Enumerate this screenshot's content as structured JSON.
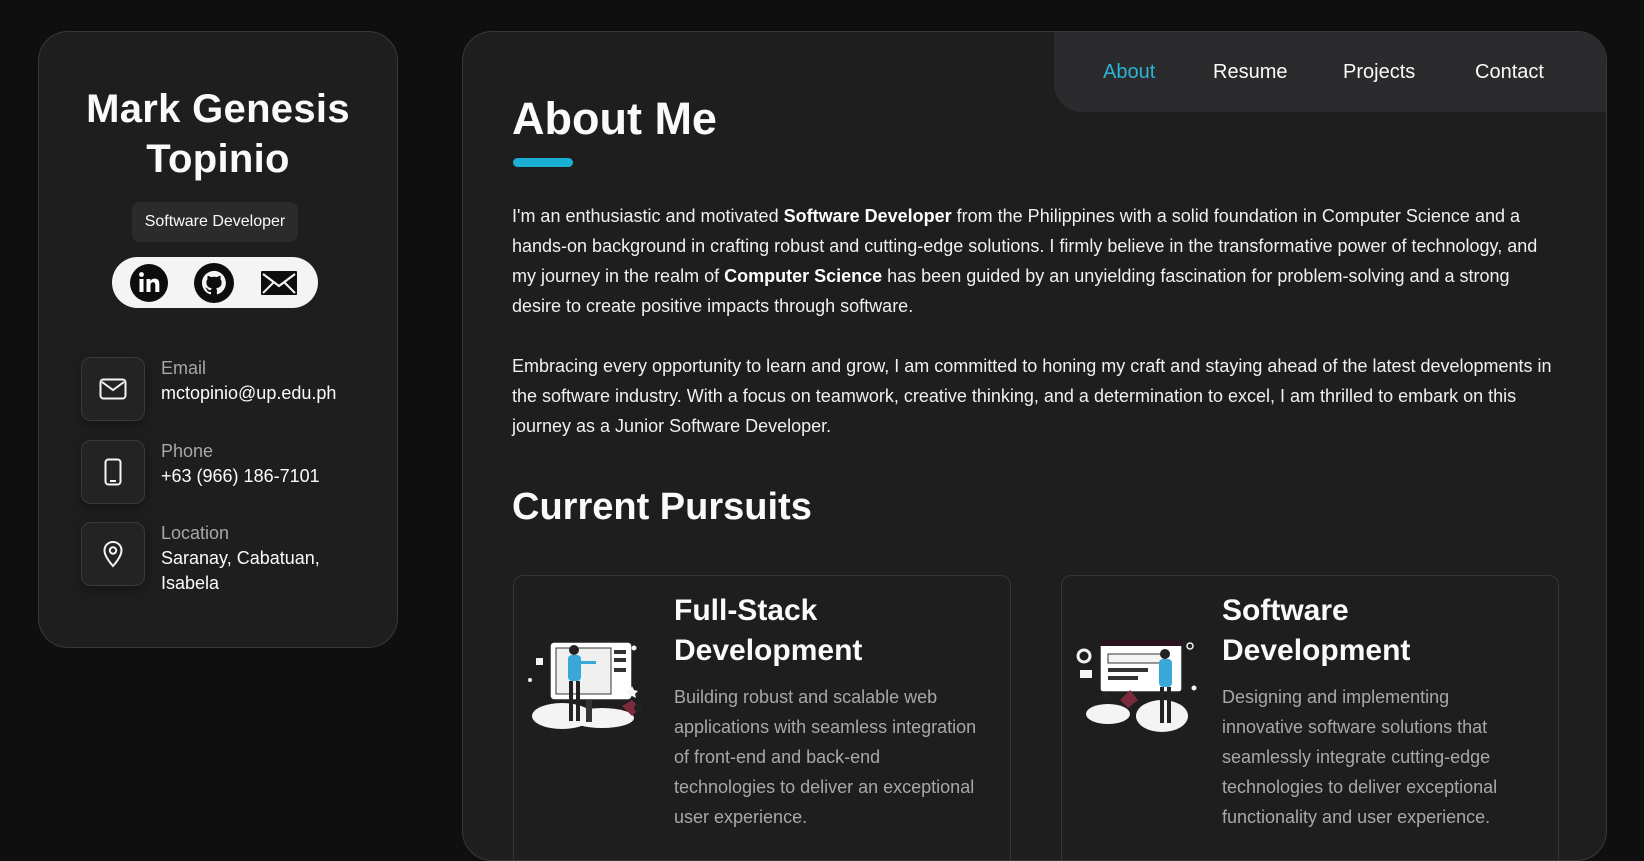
{
  "profile": {
    "name": "Mark Genesis Topinio",
    "role": "Software Developer"
  },
  "social": [
    {
      "icon": "linkedin-icon"
    },
    {
      "icon": "github-icon"
    },
    {
      "icon": "mail-icon"
    }
  ],
  "contacts": [
    {
      "label": "Email",
      "value": "mctopinio@up.edu.ph",
      "icon": "envelope-icon"
    },
    {
      "label": "Phone",
      "value": "+63 (966) 186-7101",
      "icon": "phone-icon"
    },
    {
      "label": "Location",
      "value": "Saranay, Cabatuan, Isabela",
      "icon": "location-pin-icon"
    }
  ],
  "nav": {
    "items": [
      "About",
      "Resume",
      "Projects",
      "Contact"
    ],
    "active": "About",
    "accent": "#29b5d6"
  },
  "about": {
    "title": "About Me",
    "p1": {
      "a": "I'm an enthusiastic and motivated ",
      "b": "Software Developer",
      "c": " from the Philippines with a solid foundation in Computer Science and a hands-on background in crafting robust and cutting-edge solutions. I firmly believe in the transformative power of technology, and my journey in the realm of ",
      "d": "Computer Science",
      "e": " has been guided by an unyielding fascination for problem-solving and a strong desire to create positive impacts through software."
    },
    "p2": "Embracing every opportunity to learn and grow, I am committed to honing my craft and staying ahead of the latest developments in the software industry. With a focus on teamwork, creative thinking, and a determination to excel, I am thrilled to embark on this journey as a Junior Software Developer."
  },
  "pursuits": {
    "title": "Current Pursuits",
    "cards": [
      {
        "title": "Full-Stack Development",
        "desc": "Building robust and scalable web applications with seamless integration of front-end and back-end technologies to deliver an exceptional user experience."
      },
      {
        "title": "Software Development",
        "desc": "Designing and implementing innovative software solutions that seamlessly integrate cutting-edge technologies to deliver exceptional functionality and user experience."
      }
    ]
  }
}
